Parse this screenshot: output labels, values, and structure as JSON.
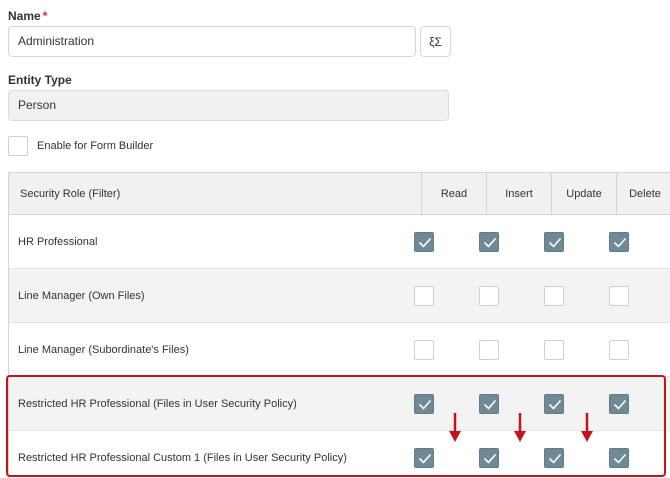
{
  "name_field": {
    "label": "Name",
    "required_marker": "*",
    "value": "Administration",
    "formula_icon": "formula-icon",
    "formula_glyph": "ξΣ"
  },
  "entity_type": {
    "label": "Entity Type",
    "value": "Person"
  },
  "form_builder": {
    "label": "Enable for Form Builder",
    "checked": false
  },
  "permissions_table": {
    "columns": [
      "Security Role (Filter)",
      "Read",
      "Insert",
      "Update",
      "Delete"
    ],
    "rows": [
      {
        "role": "HR Professional",
        "read": true,
        "insert": true,
        "update": true,
        "delete": true
      },
      {
        "role": "Line Manager (Own Files)",
        "read": false,
        "insert": false,
        "update": false,
        "delete": false
      },
      {
        "role": "Line Manager (Subordinate's Files)",
        "read": false,
        "insert": false,
        "update": false,
        "delete": false
      },
      {
        "role": "Restricted HR Professional (Files in User Security Policy)",
        "read": true,
        "insert": true,
        "update": true,
        "delete": true
      },
      {
        "role": "Restricted HR Professional Custom 1 (Files in User Security Policy)",
        "read": true,
        "insert": true,
        "update": true,
        "delete": true
      }
    ]
  },
  "annotation": {
    "highlight_color": "#c0151b",
    "arrow_color": "#c0151b",
    "arrow_count": 3
  },
  "colors": {
    "checked": "#6f8a94",
    "header_bg": "#f1f1f1",
    "alt_row_bg": "#f3f3f3",
    "required": "#d32f2f"
  }
}
